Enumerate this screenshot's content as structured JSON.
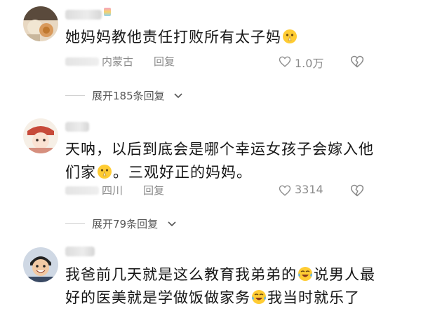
{
  "comments": [
    {
      "text_parts": [
        "她妈妈教他责任打败所有太子妈",
        ""
      ],
      "location": "内蒙古",
      "reply_label": "回复",
      "likes": "1.0万",
      "expand_label": "展开185条回复"
    },
    {
      "text_line1": "天呐，以后到底会是哪个幸运女孩子会嫁入他",
      "text_line2_a": "们家",
      "text_line2_b": "。三观好正的妈妈。",
      "location": "四川",
      "reply_label": "回复",
      "likes": "3314",
      "expand_label": "展开79条回复"
    },
    {
      "text_line1_a": "我爸前几天就是这么教育我弟弟的",
      "text_line1_b": "说男人最",
      "text_line2_a": "好的医美就是学做饭做家务",
      "text_line2_b": "我当时就乐了"
    }
  ],
  "icons": {
    "like": "heart-outline-icon",
    "dislike": "broken-heart-icon",
    "expand": "chevron-down-icon",
    "pray_emoji": "pray-emoji-icon",
    "laugh_cry_emoji": "laugh-cry-emoji-icon"
  },
  "colors": {
    "text": "#161616",
    "meta": "#8a8a8a",
    "expand": "#555555"
  }
}
